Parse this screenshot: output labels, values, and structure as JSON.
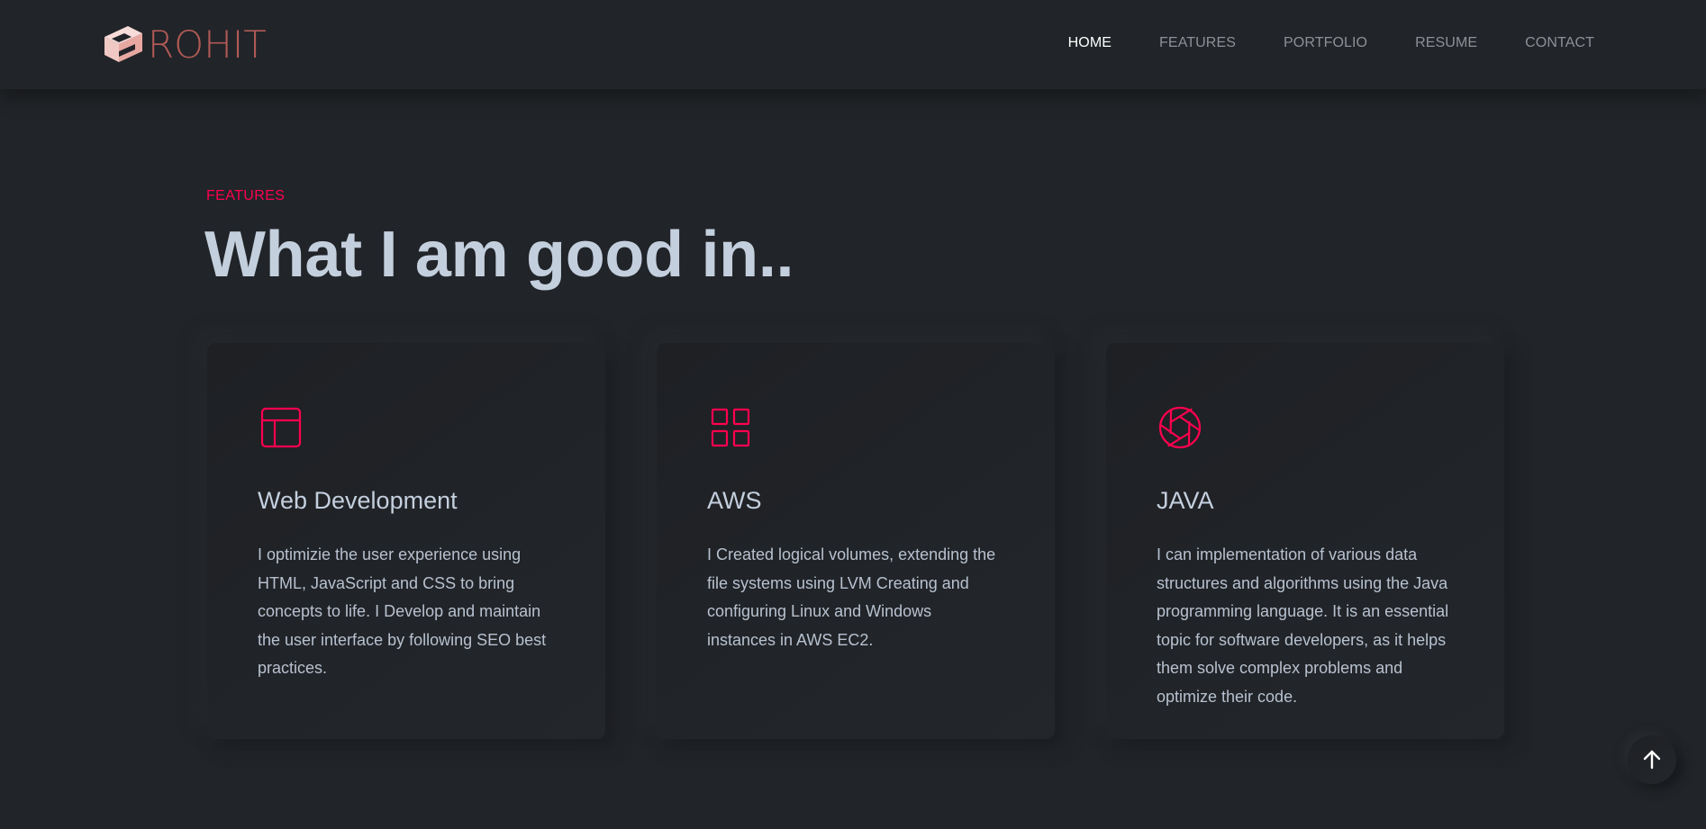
{
  "brand": {
    "logo_text": "ROHIT",
    "logo_color": "#b05a55",
    "logo_icon": "logo-mark-icon"
  },
  "nav": {
    "items": [
      {
        "label": "HOME",
        "active": true
      },
      {
        "label": "FEATURES",
        "active": false
      },
      {
        "label": "PORTFOLIO",
        "active": false
      },
      {
        "label": "RESUME",
        "active": false
      },
      {
        "label": "CONTACT",
        "active": false
      }
    ]
  },
  "section": {
    "subtitle": "FEATURES",
    "title": "What I am good in.."
  },
  "cards": [
    {
      "icon": "layout-icon",
      "title": "Web Development",
      "description": "I optimizie the user experience using HTML, JavaScript and CSS to bring concepts to life. I Develop and maintain the user interface by following SEO best practices."
    },
    {
      "icon": "grid-icon",
      "title": "AWS",
      "description": "I Created logical volumes, extending the file systems using LVM Creating and configuring Linux and Windows instances in AWS EC2."
    },
    {
      "icon": "aperture-icon",
      "title": "JAVA",
      "description": "I can implementation of various data structures and algorithms using the Java programming language. It is an essential topic for software developers, as it helps them solve complex problems and optimize their code."
    }
  ],
  "back_to_top": {
    "icon": "arrow-up-icon"
  },
  "colors": {
    "background": "#212428",
    "accent": "#ff014f",
    "heading": "#c4cfde",
    "nav_inactive": "#8d9096"
  }
}
